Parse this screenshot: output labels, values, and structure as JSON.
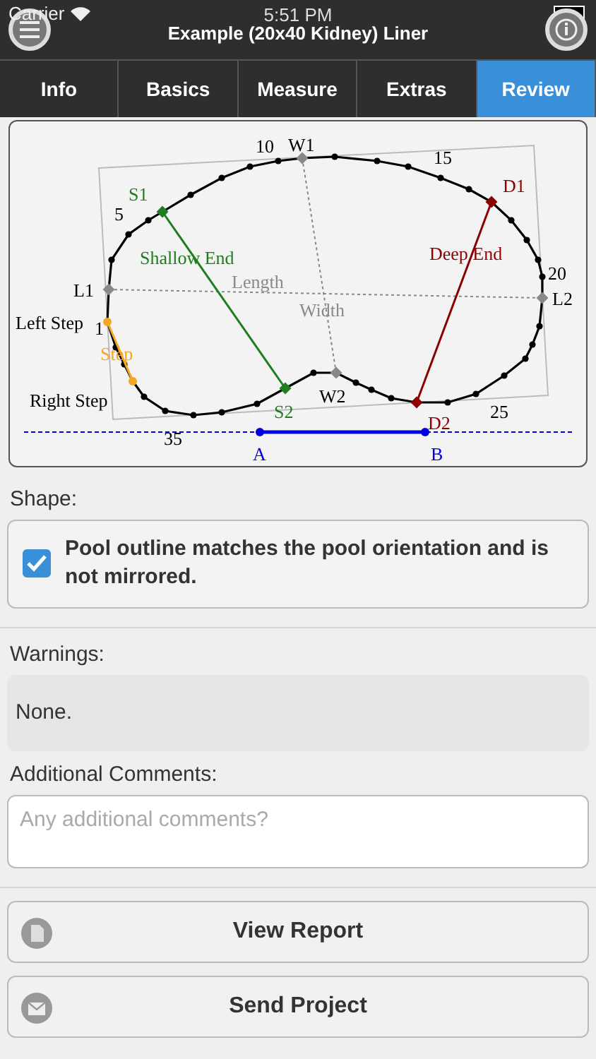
{
  "status_bar": {
    "carrier": "Carrier",
    "time": "5:51 PM"
  },
  "header": {
    "title": "Example (20x40 Kidney) Liner"
  },
  "tabs": [
    {
      "label": "Info",
      "selected": false
    },
    {
      "label": "Basics",
      "selected": false
    },
    {
      "label": "Measure",
      "selected": false
    },
    {
      "label": "Extras",
      "selected": false
    },
    {
      "label": "Review",
      "selected": true
    }
  ],
  "diagram": {
    "labels": [
      {
        "text": "10",
        "color": "#000000"
      },
      {
        "text": "W1",
        "color": "#000000"
      },
      {
        "text": "15",
        "color": "#000000"
      },
      {
        "text": "S1",
        "color": "#1e7d1e"
      },
      {
        "text": "D1",
        "color": "#8b0000"
      },
      {
        "text": "5",
        "color": "#000000"
      },
      {
        "text": "Shallow End",
        "color": "#1e7d1e"
      },
      {
        "text": "Deep End",
        "color": "#8b0000"
      },
      {
        "text": "20",
        "color": "#000000"
      },
      {
        "text": "L1",
        "color": "#000000"
      },
      {
        "text": "Length",
        "color": "#8a8a8a"
      },
      {
        "text": "L2",
        "color": "#000000"
      },
      {
        "text": "Width",
        "color": "#8a8a8a"
      },
      {
        "text": "Left Step",
        "color": "#000000"
      },
      {
        "text": "1",
        "color": "#000000"
      },
      {
        "text": "Step",
        "color": "#f5a623"
      },
      {
        "text": "Right Step",
        "color": "#000000"
      },
      {
        "text": "W2",
        "color": "#000000"
      },
      {
        "text": "S2",
        "color": "#1e7d1e"
      },
      {
        "text": "D2",
        "color": "#8b0000"
      },
      {
        "text": "25",
        "color": "#000000"
      },
      {
        "text": "35",
        "color": "#000000"
      },
      {
        "text": "A",
        "color": "#0000dd"
      },
      {
        "text": "B",
        "color": "#0000dd"
      }
    ]
  },
  "shape": {
    "label": "Shape:",
    "checkbox": {
      "text": "Pool outline matches the pool orientation and is not mirrored.",
      "checked": true
    }
  },
  "warnings": {
    "label": "Warnings:",
    "text": "None."
  },
  "comments": {
    "label": "Additional Comments:",
    "placeholder": "Any additional comments?"
  },
  "buttons": [
    {
      "label": "View Report",
      "kind": "report"
    },
    {
      "label": "Send Project",
      "kind": "send"
    }
  ]
}
